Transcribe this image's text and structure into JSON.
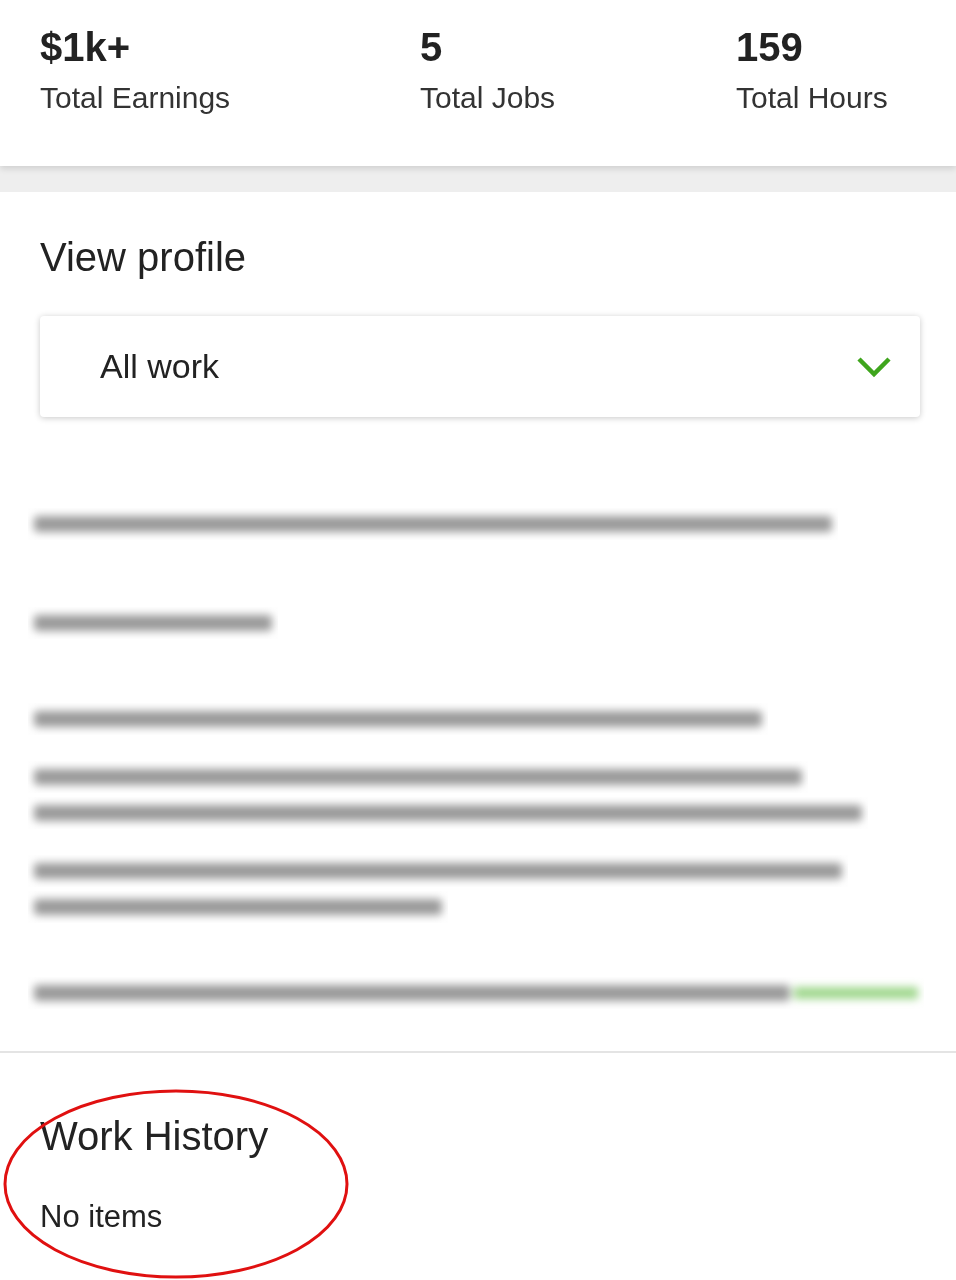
{
  "stats": [
    {
      "value": "$1k+",
      "label": "Total Earnings"
    },
    {
      "value": "5",
      "label": "Total Jobs"
    },
    {
      "value": "159",
      "label": "Total Hours"
    }
  ],
  "view_profile": {
    "title": "View profile",
    "dropdown": {
      "value": "All work"
    }
  },
  "work_history": {
    "title": "Work History",
    "empty_text": "No items"
  }
}
